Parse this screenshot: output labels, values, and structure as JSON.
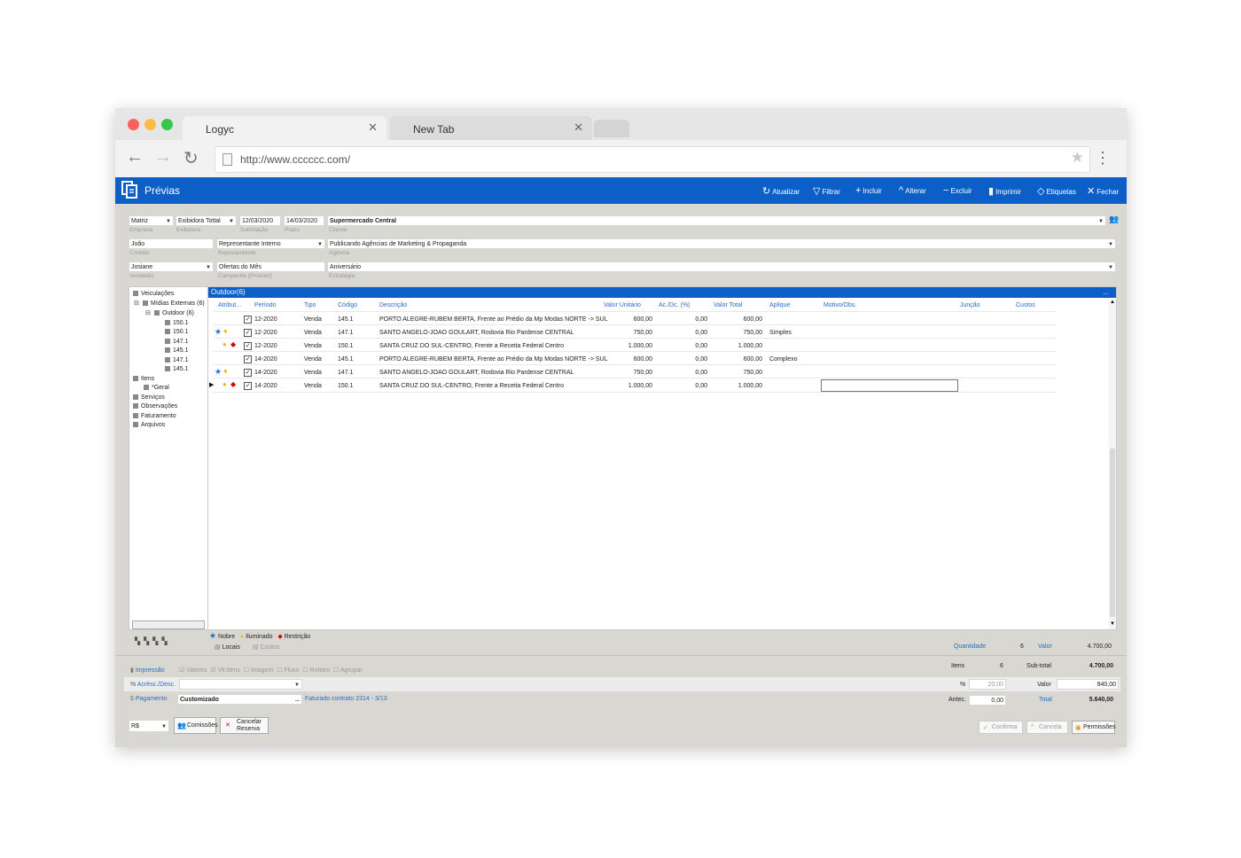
{
  "browser": {
    "tabs": [
      {
        "label": "Logyc"
      },
      {
        "label": "New Tab"
      }
    ],
    "url": "http://www.cccccc.com/"
  },
  "app": {
    "title": "Prévias",
    "accent": "#0b5fc7",
    "toolbar": [
      {
        "icon": "refresh-icon",
        "glyph": "↻",
        "label": "Atualizar"
      },
      {
        "icon": "filter-icon",
        "glyph": "▽",
        "label": "Filtrar"
      },
      {
        "icon": "plus-icon",
        "glyph": "+",
        "label": "Incluir"
      },
      {
        "icon": "chevron-up-icon",
        "glyph": "^",
        "label": "Alterar"
      },
      {
        "icon": "minus-icon",
        "glyph": "−",
        "label": "Excluir"
      },
      {
        "icon": "printer-icon",
        "glyph": "▮",
        "label": "Imprimir"
      },
      {
        "icon": "tag-icon",
        "glyph": "◇",
        "label": "Etiquetas"
      },
      {
        "icon": "close-icon",
        "glyph": "✕",
        "label": "Fechar"
      }
    ]
  },
  "form": {
    "empresa": {
      "value": "Matriz",
      "label": "Empresa"
    },
    "exibidora": {
      "value": "Exibidora Tottal",
      "label": "Exibidora"
    },
    "solicitacao": {
      "value": "12/03/2020",
      "label": "Solicitação"
    },
    "prazo": {
      "value": "14/03/2020",
      "label": "Prazo"
    },
    "cliente": {
      "value": "Supermercado Central",
      "label": "Cliente"
    },
    "contato": {
      "value": "João",
      "label": "Contato"
    },
    "representante": {
      "value": "Representante Interno",
      "label": "Representante"
    },
    "agencia": {
      "value": "Publicando Agências de Marketing & Propaganda",
      "label": "Agência"
    },
    "vendedor": {
      "value": "Josiane",
      "label": "Vendedor"
    },
    "campanha": {
      "value": "Ofertas do Mês",
      "label": "Campanha (Produto)"
    },
    "estrategia": {
      "value": "Aniversário",
      "label": "Estratégia"
    }
  },
  "tree": {
    "veiculacoes": "Veiculações",
    "midias": "Mídias Externas (6)",
    "outdoor": "Outdoor (6)",
    "codes": [
      "150.1",
      "150.1",
      "147.1",
      "145.1",
      "147.1",
      "145.1"
    ],
    "itens": "Itens",
    "geral": "*Geral",
    "servicos": "Serviços",
    "observacoes": "Observações",
    "faturamento": "Faturamento",
    "arquivos": "Arquivos"
  },
  "grid": {
    "title": "Outdoor(6)",
    "more": "...",
    "columns": [
      "Atribut...",
      "Período",
      "Tipo",
      "Código",
      "Descrição",
      "Valor Unitário",
      "Ac./Dc. (%)",
      "Valor Total",
      "Aplique",
      "Motivo/Obs.",
      "Junção",
      "Custos"
    ],
    "rows": [
      {
        "attrs": "",
        "periodo": "12-2020",
        "tipo": "Venda",
        "codigo": "145.1",
        "descricao": "PORTO ALEGRE-RUBEM BERTA, Frente ao Prédio da Mp Modas NORTE -> SUL",
        "unitario": "600,00",
        "acdc": "0,00",
        "total": "600,00",
        "aplique": ""
      },
      {
        "attrs": "star-bulb",
        "periodo": "12-2020",
        "tipo": "Venda",
        "codigo": "147.1",
        "descricao": "SANTO ANGELO-JOAO GOULART, Rodovia Rio Pardense CENTRAL",
        "unitario": "750,00",
        "acdc": "0,00",
        "total": "750,00",
        "aplique": "Simples"
      },
      {
        "attrs": "bulb-diamond",
        "periodo": "12-2020",
        "tipo": "Venda",
        "codigo": "150.1",
        "descricao": "SANTA CRUZ DO SUL-CENTRO, Frente a Receita Federal Centro",
        "unitario": "1.000,00",
        "acdc": "0,00",
        "total": "1.000,00",
        "aplique": ""
      },
      {
        "attrs": "",
        "periodo": "14-2020",
        "tipo": "Venda",
        "codigo": "145.1",
        "descricao": "PORTO ALEGRE-RUBEM BERTA, Frente ao Prédio da Mp Modas NORTE -> SUL",
        "unitario": "600,00",
        "acdc": "0,00",
        "total": "600,00",
        "aplique": "Complexo"
      },
      {
        "attrs": "star-bulb",
        "periodo": "14-2020",
        "tipo": "Venda",
        "codigo": "147.1",
        "descricao": "SANTO ANGELO-JOAO GOULART, Rodovia Rio Pardense CENTRAL",
        "unitario": "750,00",
        "acdc": "0,00",
        "total": "750,00",
        "aplique": ""
      },
      {
        "attrs": "bulb-diamond",
        "periodo": "14-2020",
        "tipo": "Venda",
        "codigo": "150.1",
        "descricao": "SANTA CRUZ DO SUL-CENTRO, Frente a Receita Federal Centro",
        "unitario": "1.000,00",
        "acdc": "0,00",
        "total": "1.000,00",
        "aplique": ""
      }
    ],
    "legend": {
      "nobre": "Nobre",
      "iluminado": "Iluminado",
      "restricao": "Restrição",
      "locais": "Locais",
      "custos": "Custos"
    },
    "quantidade_label": "Quantidade",
    "quantidade": "6",
    "valor_label": "Valor",
    "valor": "4.700,00"
  },
  "bottom": {
    "impressao": "Impressão",
    "options": [
      {
        "label": "Valores",
        "checked": true
      },
      {
        "label": "Vlr.Itens",
        "checked": true
      },
      {
        "label": "Imagem",
        "checked": false
      },
      {
        "label": "Fluxo",
        "checked": false
      },
      {
        "label": "Roteiro",
        "checked": false
      },
      {
        "label": "Agrupar",
        "checked": false
      }
    ],
    "acresc_label": "Acrésc./Desc.",
    "pagamento_label": "Pagamento",
    "pagamento_value": "Customizado",
    "pagamento_more": "...",
    "faturado": "Faturado contrato 2314 - 3/13",
    "moeda": "R$",
    "comissoes": "Comissões",
    "cancelar_reserva": [
      "Cancelar",
      "Reserva"
    ],
    "itens_label": "Itens",
    "itens": "6",
    "subtotal_label": "Sub-total",
    "subtotal": "4.700,00",
    "pct_label": "%",
    "pct": "20,00",
    "valor_label": "Valor",
    "valor": "940,00",
    "antec_label": "Antec.",
    "antec": "0,00",
    "total_label": "Total",
    "total": "5.640,00",
    "confirma": "Confirma",
    "cancela": "Cancela",
    "permissoes": "Permissões"
  }
}
